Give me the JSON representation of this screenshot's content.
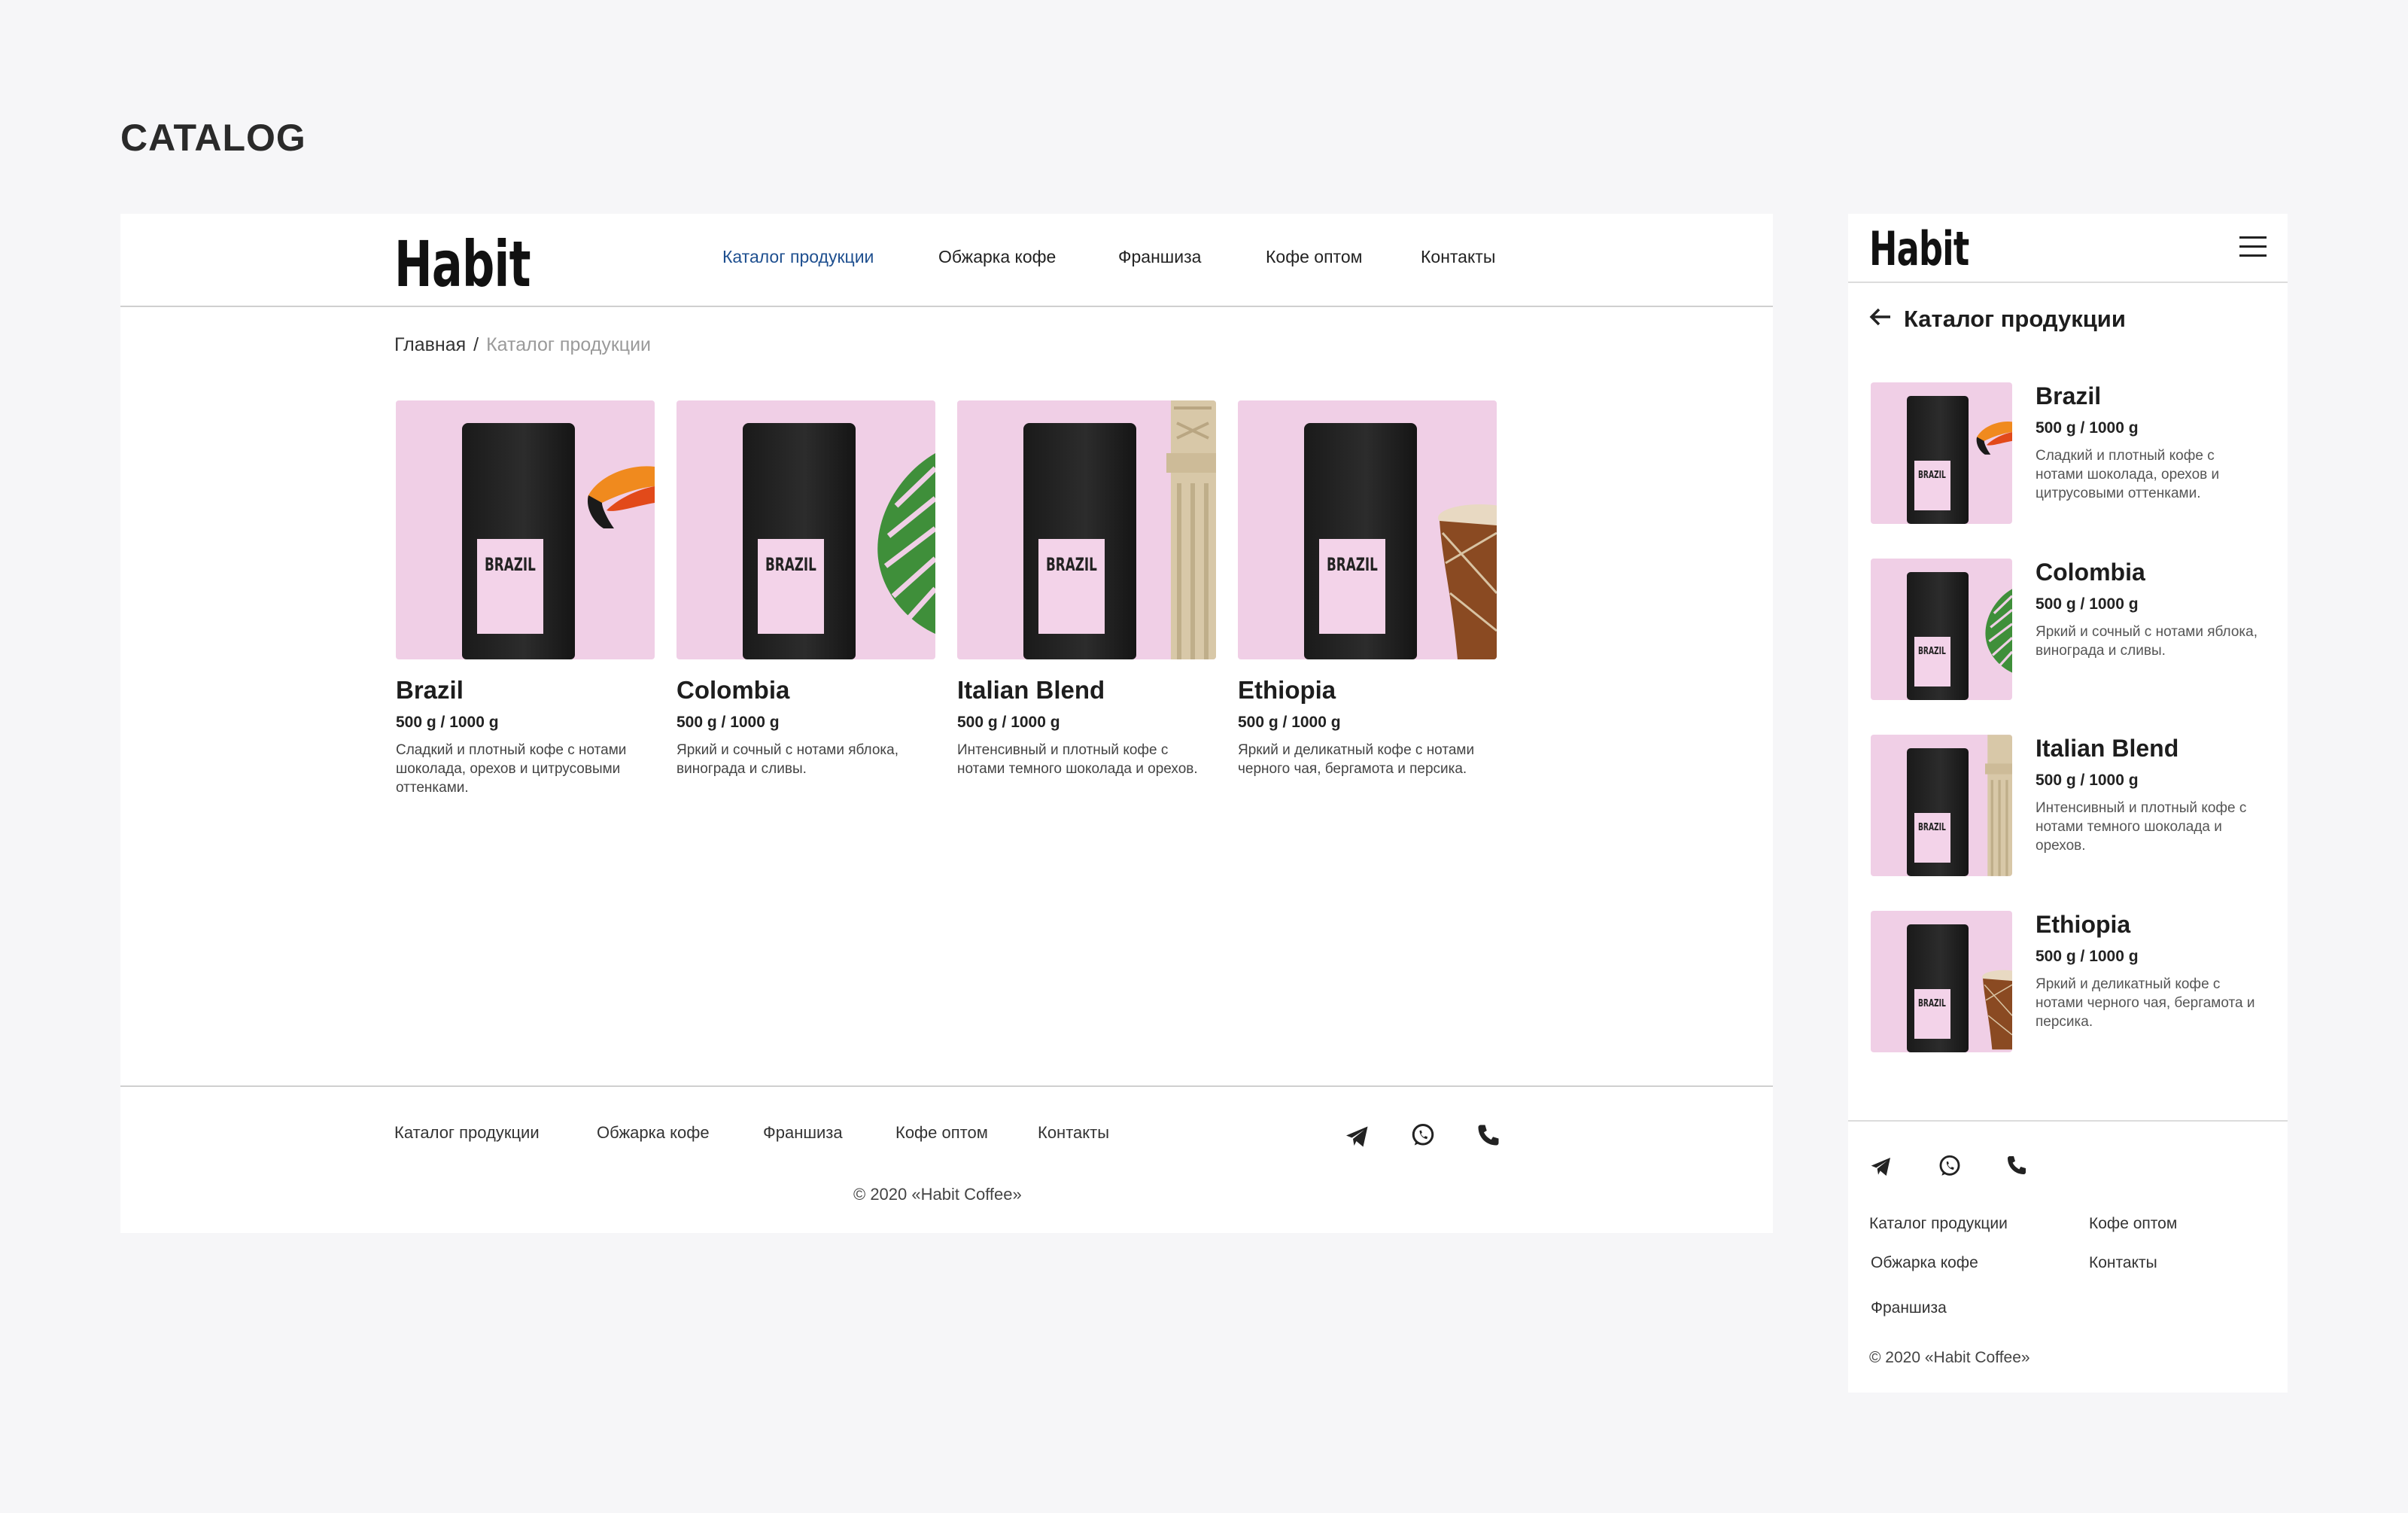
{
  "page_title": "CATALOG",
  "brand": "Habit",
  "nav": [
    "Каталог продукции",
    "Обжарка кофе",
    "Франшиза",
    "Кофе оптом",
    "Контакты"
  ],
  "nav_active": "Каталог продукции",
  "breadcrumb": {
    "home": "Главная",
    "separator": "/",
    "current": "Каталог продукции"
  },
  "mobile_heading": "Каталог продукции",
  "products": [
    {
      "name": "Brazil",
      "weight": "500 g / 1000 g",
      "desc": "Сладкий и плотный кофе с нотами шоколада, орехов и цитрусовыми оттенками.",
      "package_label": "BRAZIL",
      "decor": "toucan"
    },
    {
      "name": "Colombia",
      "weight": "500 g / 1000 g",
      "desc": "Яркий и сочный с нотами яблока, винограда и сливы.",
      "package_label": "BRAZIL",
      "decor": "monstera-leaf"
    },
    {
      "name": "Italian Blend",
      "weight": "500 g / 1000 g",
      "desc": "Интенсивный и плотный кофе с нотами темного шоколада и орехов.",
      "package_label": "BRAZIL",
      "decor": "stone-column"
    },
    {
      "name": "Ethiopia",
      "weight": "500 g / 1000 g",
      "desc": "Яркий и деликатный кофе с нотами черного чая, бергамота и персика.",
      "package_label": "BRAZIL",
      "decor": "djembe-drum"
    }
  ],
  "footer": {
    "links": [
      "Каталог продукции",
      "Обжарка кофе",
      "Франшиза",
      "Кофе оптом",
      "Контакты"
    ],
    "social_icons": [
      "telegram-icon",
      "whatsapp-icon",
      "phone-icon"
    ],
    "copyright": "© 2020 «Habit Coffee»"
  },
  "colors": {
    "accent": "#1e4f8f",
    "card_background": "#f0cfe6",
    "page_background": "#f6f6f8",
    "package": "#1f1f1f"
  }
}
